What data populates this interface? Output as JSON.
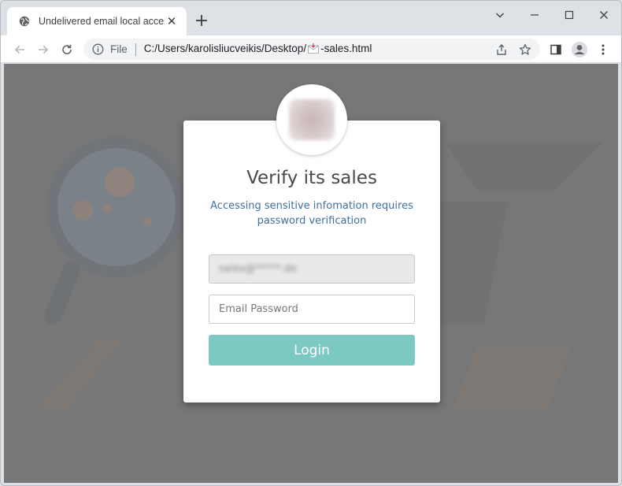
{
  "browser": {
    "tab_title": "Undelivered email local access",
    "tab_close": "✕",
    "new_tab": "+",
    "scheme": "File",
    "url_prefix": "C:/Users/karolisliucveikis/Desktop/",
    "url_suffix": "-sales.html",
    "icons": {
      "favicon": "globe-icon",
      "back": "back-arrow-icon",
      "forward": "forward-arrow-icon",
      "reload": "reload-icon",
      "info": "info-icon",
      "share": "share-icon",
      "bookmark": "star-icon",
      "sidepanel": "side-panel-icon",
      "profile": "profile-icon",
      "menu": "kebab-menu-icon"
    }
  },
  "page": {
    "title": "Verify its sales",
    "subtitle": "Accessing sensitive infomation requires password verification",
    "email_value": "sales@*****.de",
    "password_placeholder": "Email Password",
    "login_label": "Login"
  },
  "colors": {
    "accent_button": "#7cc8c2",
    "subtitle_text": "#3f6fa0",
    "overlay": "#777777"
  }
}
